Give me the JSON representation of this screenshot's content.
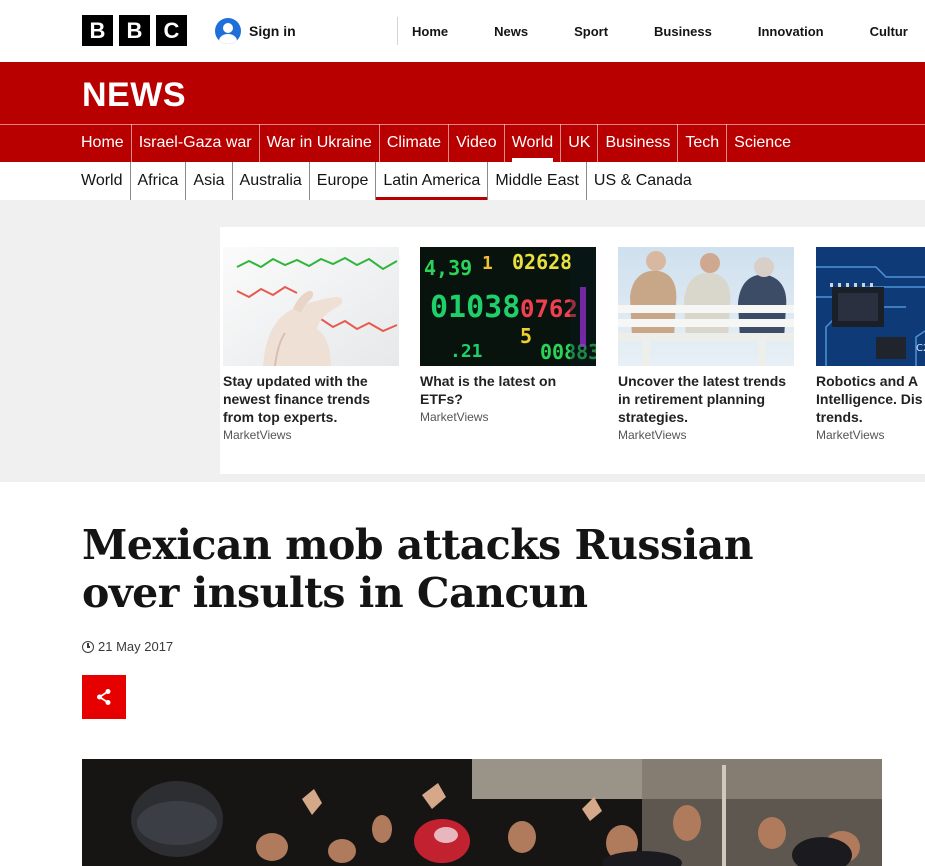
{
  "masthead": {
    "logo_letters": [
      "B",
      "B",
      "C"
    ],
    "signin_label": "Sign in",
    "nav": [
      "Home",
      "News",
      "Sport",
      "Business",
      "Innovation",
      "Cultur"
    ]
  },
  "news": {
    "brand": "NEWS",
    "primary_nav": [
      {
        "label": "Home",
        "active": false
      },
      {
        "label": "Israel-Gaza war",
        "active": false
      },
      {
        "label": "War in Ukraine",
        "active": false
      },
      {
        "label": "Climate",
        "active": false
      },
      {
        "label": "Video",
        "active": false
      },
      {
        "label": "World",
        "active": true
      },
      {
        "label": "UK",
        "active": false
      },
      {
        "label": "Business",
        "active": false
      },
      {
        "label": "Tech",
        "active": false
      },
      {
        "label": "Science",
        "active": false
      }
    ],
    "secondary_nav": [
      {
        "label": "World",
        "active": false
      },
      {
        "label": "Africa",
        "active": false
      },
      {
        "label": "Asia",
        "active": false
      },
      {
        "label": "Australia",
        "active": false
      },
      {
        "label": "Europe",
        "active": false
      },
      {
        "label": "Latin America",
        "active": true
      },
      {
        "label": "Middle East",
        "active": false
      },
      {
        "label": "US & Canada",
        "active": false
      }
    ]
  },
  "ads": [
    {
      "title": "Stay updated with the newest finance trends from top experts.",
      "source": "MarketViews",
      "image": "finance-chart-hand"
    },
    {
      "title": "What is the latest on ETFs?",
      "source": "MarketViews",
      "image": "stock-ticker-board"
    },
    {
      "title": "Uncover the latest trends in retirement planning strategies.",
      "source": "MarketViews",
      "image": "elderly-men-on-bench"
    },
    {
      "title": "Robotics and A Intelligence. Dis the trends.",
      "source": "MarketViews",
      "image": "circuit-board"
    }
  ],
  "article": {
    "headline": "Mexican mob attacks Russian over insults in Cancun",
    "date": "21 May 2017",
    "share_icon": "share-icon"
  },
  "colors": {
    "brand_red": "#b80000",
    "share_red": "#e60000",
    "ad_band_gray": "#f0f0f0"
  }
}
